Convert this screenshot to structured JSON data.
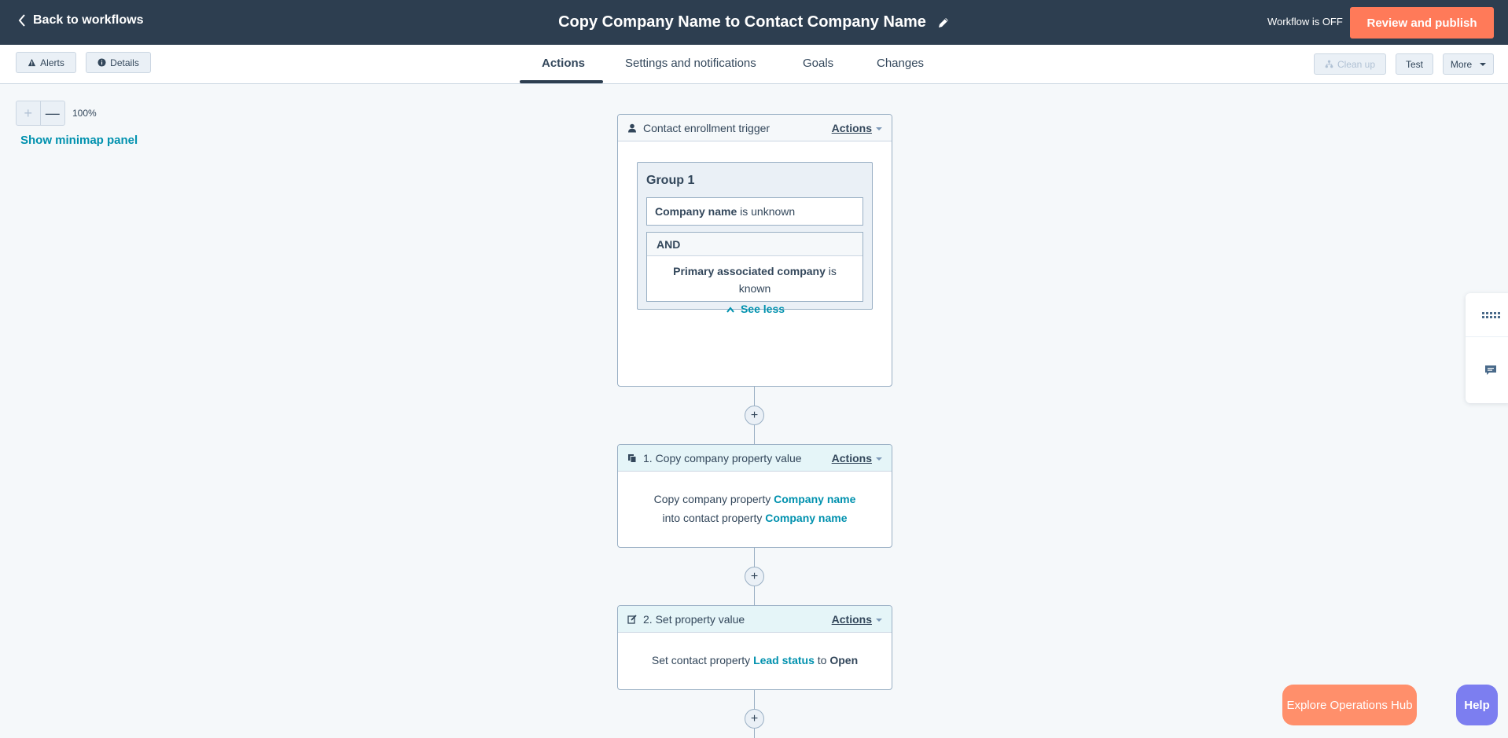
{
  "topbar": {
    "back_label": "Back to workflows",
    "title": "Copy Company Name to Contact Company Name",
    "status": "Workflow is OFF",
    "publish_label": "Review and publish"
  },
  "subbar": {
    "alerts_label": "Alerts",
    "details_label": "Details",
    "tabs": [
      {
        "label": "Actions",
        "active": true
      },
      {
        "label": "Settings and notifications"
      },
      {
        "label": "Goals"
      },
      {
        "label": "Changes"
      }
    ],
    "cleanup_label": "Clean up",
    "test_label": "Test",
    "more_label": "More"
  },
  "canvas": {
    "zoom_plus": "+",
    "zoom_minus": "—",
    "zoom_level": "100%",
    "minimap_label": "Show minimap panel",
    "add_symbol": "+"
  },
  "trigger": {
    "title": "Contact enrollment trigger",
    "actions_label": "Actions",
    "group_title": "Group 1",
    "cond1_property": "Company name",
    "cond1_operator": "is unknown",
    "and_label": "AND",
    "cond2_property": "Primary associated company",
    "cond2_operator": "is known",
    "see_less_label": "See less"
  },
  "action1": {
    "title": "1. Copy company property value",
    "actions_label": "Actions",
    "line1_prefix": "Copy company property",
    "line1_link": "Company name",
    "line2_prefix": "into contact property",
    "line2_link": "Company name"
  },
  "action2": {
    "title": "2. Set property value",
    "actions_label": "Actions",
    "prefix": "Set contact property",
    "link": "Lead status",
    "middle": "to",
    "value": "Open"
  },
  "floating": {
    "explore_label": "Explore Operations Hub",
    "help_label": "Help"
  },
  "colors": {
    "topbar": "#2d3e50",
    "accent": "#ff7a59",
    "link": "#0091ae",
    "help": "#7c7ef0"
  }
}
